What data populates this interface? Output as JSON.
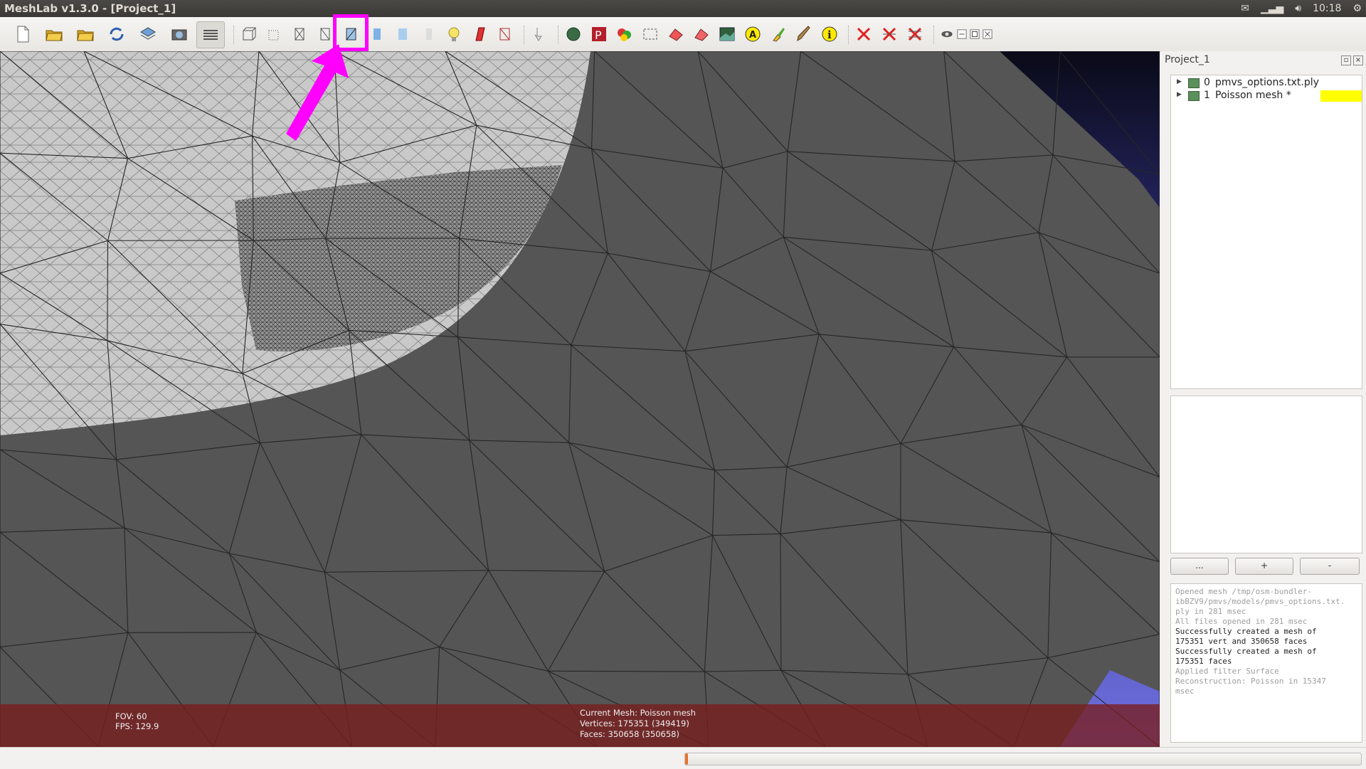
{
  "window": {
    "title": "MeshLab v1.3.0 - [Project_1]",
    "clock": "10:18"
  },
  "tray_icons": [
    "mail-icon",
    "network-icon",
    "volume-icon",
    "gear-icon"
  ],
  "toolbar": {
    "buttons": [
      "new-file-icon",
      "open-folder-icon",
      "open-folder-plus-icon",
      "reload-icon",
      "save-icon",
      "snapshot-icon",
      "layers-icon",
      "bbox-icon",
      "points-icon",
      "wireframe-icon",
      "hidden-lines-icon",
      "flat-lines-icon",
      "flat-icon",
      "smooth-icon",
      "texture-icon",
      "light-icon",
      "fancy-lighting-icon",
      "backface-icon",
      "manipulator-icon",
      "select-vertices-icon",
      "paint-icon",
      "select-faces-icon",
      "select-connected-icon",
      "mesh-painter-icon",
      "raster-icon",
      "annotation-icon",
      "measure-icon",
      "brush-icon",
      "info-icon",
      "delete-faces-icon",
      "delete-vertices-icon",
      "delete-all-icon",
      "eye-icon",
      "minimize-icon",
      "restore-icon",
      "close-icon"
    ],
    "highlighted": "flat-lines-icon"
  },
  "viewport": {
    "fov_label": "FOV: 60",
    "fps_label": "FPS:   129.9",
    "current_mesh": "Current Mesh: Poisson mesh",
    "vertices": "Vertices: 175351 (349419)",
    "faces": "Faces: 350658 (350658)"
  },
  "panel": {
    "title": "Project_1",
    "layers": [
      {
        "index": "0",
        "name": "pmvs_options.txt.ply",
        "selected": false
      },
      {
        "index": "1",
        "name": "Poisson mesh *",
        "selected": true
      }
    ],
    "buttons": [
      "...",
      "+",
      "-"
    ],
    "log": [
      {
        "text": "Opened mesh /tmp/osm-bundler-",
        "style": "dim"
      },
      {
        "text": "ibBZV9/pmvs/models/pmvs_options.txt.",
        "style": "dim"
      },
      {
        "text": "ply in 281 msec",
        "style": "dim"
      },
      {
        "text": "All files opened in 281 msec",
        "style": "dim"
      },
      {
        "text": "Successfully created a mesh of",
        "style": "dark"
      },
      {
        "text": "175351 vert and 350658 faces",
        "style": "dark"
      },
      {
        "text": "Successfully created a mesh of",
        "style": "dark"
      },
      {
        "text": "175351 faces",
        "style": "dark"
      },
      {
        "text": "Applied filter Surface",
        "style": "dim"
      },
      {
        "text": "Reconstruction: Poisson in 15347",
        "style": "dim"
      },
      {
        "text": "msec",
        "style": "dim"
      }
    ]
  },
  "statusbar": {
    "progress_fraction": 0.004
  },
  "colors": {
    "highlight": "#ff00ff",
    "info_bar": "#782020",
    "layer_swatch": "#ffff00",
    "mesh_dark": "#555555",
    "mesh_light": "#cfcfcf",
    "background_blue": "#6f6fe0"
  }
}
